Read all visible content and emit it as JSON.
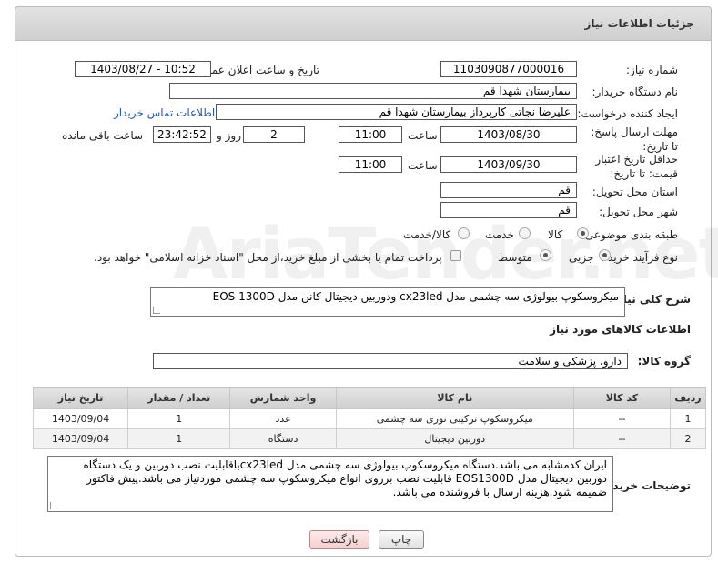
{
  "header": {
    "title": "جزئیات اطلاعات نیاز"
  },
  "form": {
    "need_number_label": "شماره نیاز:",
    "need_number": "1103090877000016",
    "announce_label": "تاریخ و ساعت اعلان عمومی:",
    "announce_value": "1403/08/27 - 10:52",
    "buyer_org_label": "نام دستگاه خریدار:",
    "buyer_org": "بیمارستان شهدا قم",
    "requester_label": "ایجاد کننده درخواست:",
    "requester": "علیرضا نجاتی کارپرداز بیمارستان شهدا قم",
    "contact_link": "اطلاعات تماس خریدار",
    "deadline_label": "مهلت ارسال پاسخ: تا تاریخ:",
    "deadline_date": "1403/08/30",
    "time_label": "ساعت",
    "deadline_time": "11:00",
    "days_value": "2",
    "days_label": "روز و",
    "remaining_time": "23:42:52",
    "remaining_label": "ساعت باقی مانده",
    "validity_label": "حداقل تاریخ اعتبار قیمت: تا تاریخ:",
    "validity_date": "1403/09/30",
    "validity_time": "11:00",
    "province_label": "استان محل تحویل:",
    "province": "قم",
    "city_label": "شهر محل تحویل:",
    "city": "قم",
    "category_label": "طبقه بندی موضوعی:",
    "category_goods": "کالا",
    "category_service": "خدمت",
    "category_both": "کالا/خدمت",
    "process_label": "نوع فرآیند خرید :",
    "process_small": "جزیی",
    "process_medium": "متوسط",
    "payment_text": "پرداخت تمام یا بخشی از مبلغ خرید،از محل \"اسناد خزانه اسلامی\" خواهد بود."
  },
  "description": {
    "label": "شرح کلی نیاز:",
    "text": "میکروسکوپ بیولوژی سه چشمی مدل cx23led ودوربین دیجیتال کانن مدل EOS 1300D"
  },
  "goods_section": {
    "title": "اطلاعات کالاهای مورد نیاز",
    "group_label": "گروه کالا:",
    "group_value": "دارو، پزشکی و سلامت"
  },
  "table": {
    "headers": [
      "ردیف",
      "کد کالا",
      "نام کالا",
      "واحد شمارش",
      "تعداد / مقدار",
      "تاریخ نیاز"
    ],
    "rows": [
      [
        "1",
        "--",
        "میکروسکوپ ترکیبی نوری سه چشمی",
        "عدد",
        "1",
        "1403/09/04"
      ],
      [
        "2",
        "--",
        "دوربین دیجیتال",
        "دستگاه",
        "1",
        "1403/09/04"
      ]
    ]
  },
  "buyer_notes": {
    "label": "توضیحات خریدار:",
    "text": "ایران کدمشابه می باشد.دستگاه میکروسکوپ بیولوژی سه چشمی مدل cx23ledباقابلیت نصب دوربین و یک دستگاه دوربین دیجیتال مدل EOS1300D قابلیت نصب برروی انواع میکروسکوپ سه چشمی موردنیاز می باشد.پیش فاکتور ضمیمه شود.هزینه ارسال با فروشنده می باشد."
  },
  "buttons": {
    "print": "چاپ",
    "back": "بازگشت"
  },
  "colors": {
    "link": "#1e57b8",
    "header_bg": "#d8d8d8",
    "back_btn": "#f4d0d0"
  }
}
